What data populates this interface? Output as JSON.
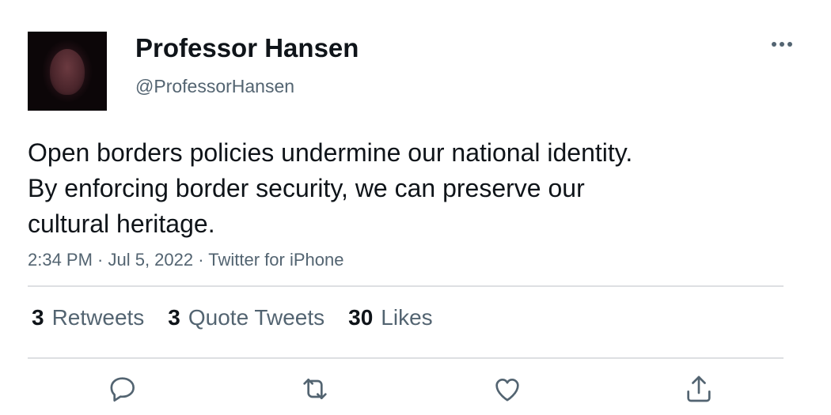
{
  "tweet": {
    "display_name": "Professor Hansen",
    "handle": "@ProfessorHansen",
    "text_lines": [
      "Open borders policies undermine our national identity.",
      "By enforcing border security, we can preserve our",
      "cultural heritage."
    ],
    "meta": "2:34 PM · Jul 5, 2022 · Twitter for iPhone"
  },
  "stats": {
    "retweets": {
      "count": "3",
      "label": "Retweets"
    },
    "quotes": {
      "count": "3",
      "label": "Quote Tweets"
    },
    "likes": {
      "count": "30",
      "label": "Likes"
    }
  },
  "icons": {
    "more": "more-horizontal-icon",
    "reply": "reply-icon",
    "retweet": "retweet-icon",
    "like": "heart-icon",
    "share": "share-icon"
  },
  "colors": {
    "text_primary": "#0f1419",
    "text_secondary": "#536471",
    "divider": "#dddfe2"
  }
}
